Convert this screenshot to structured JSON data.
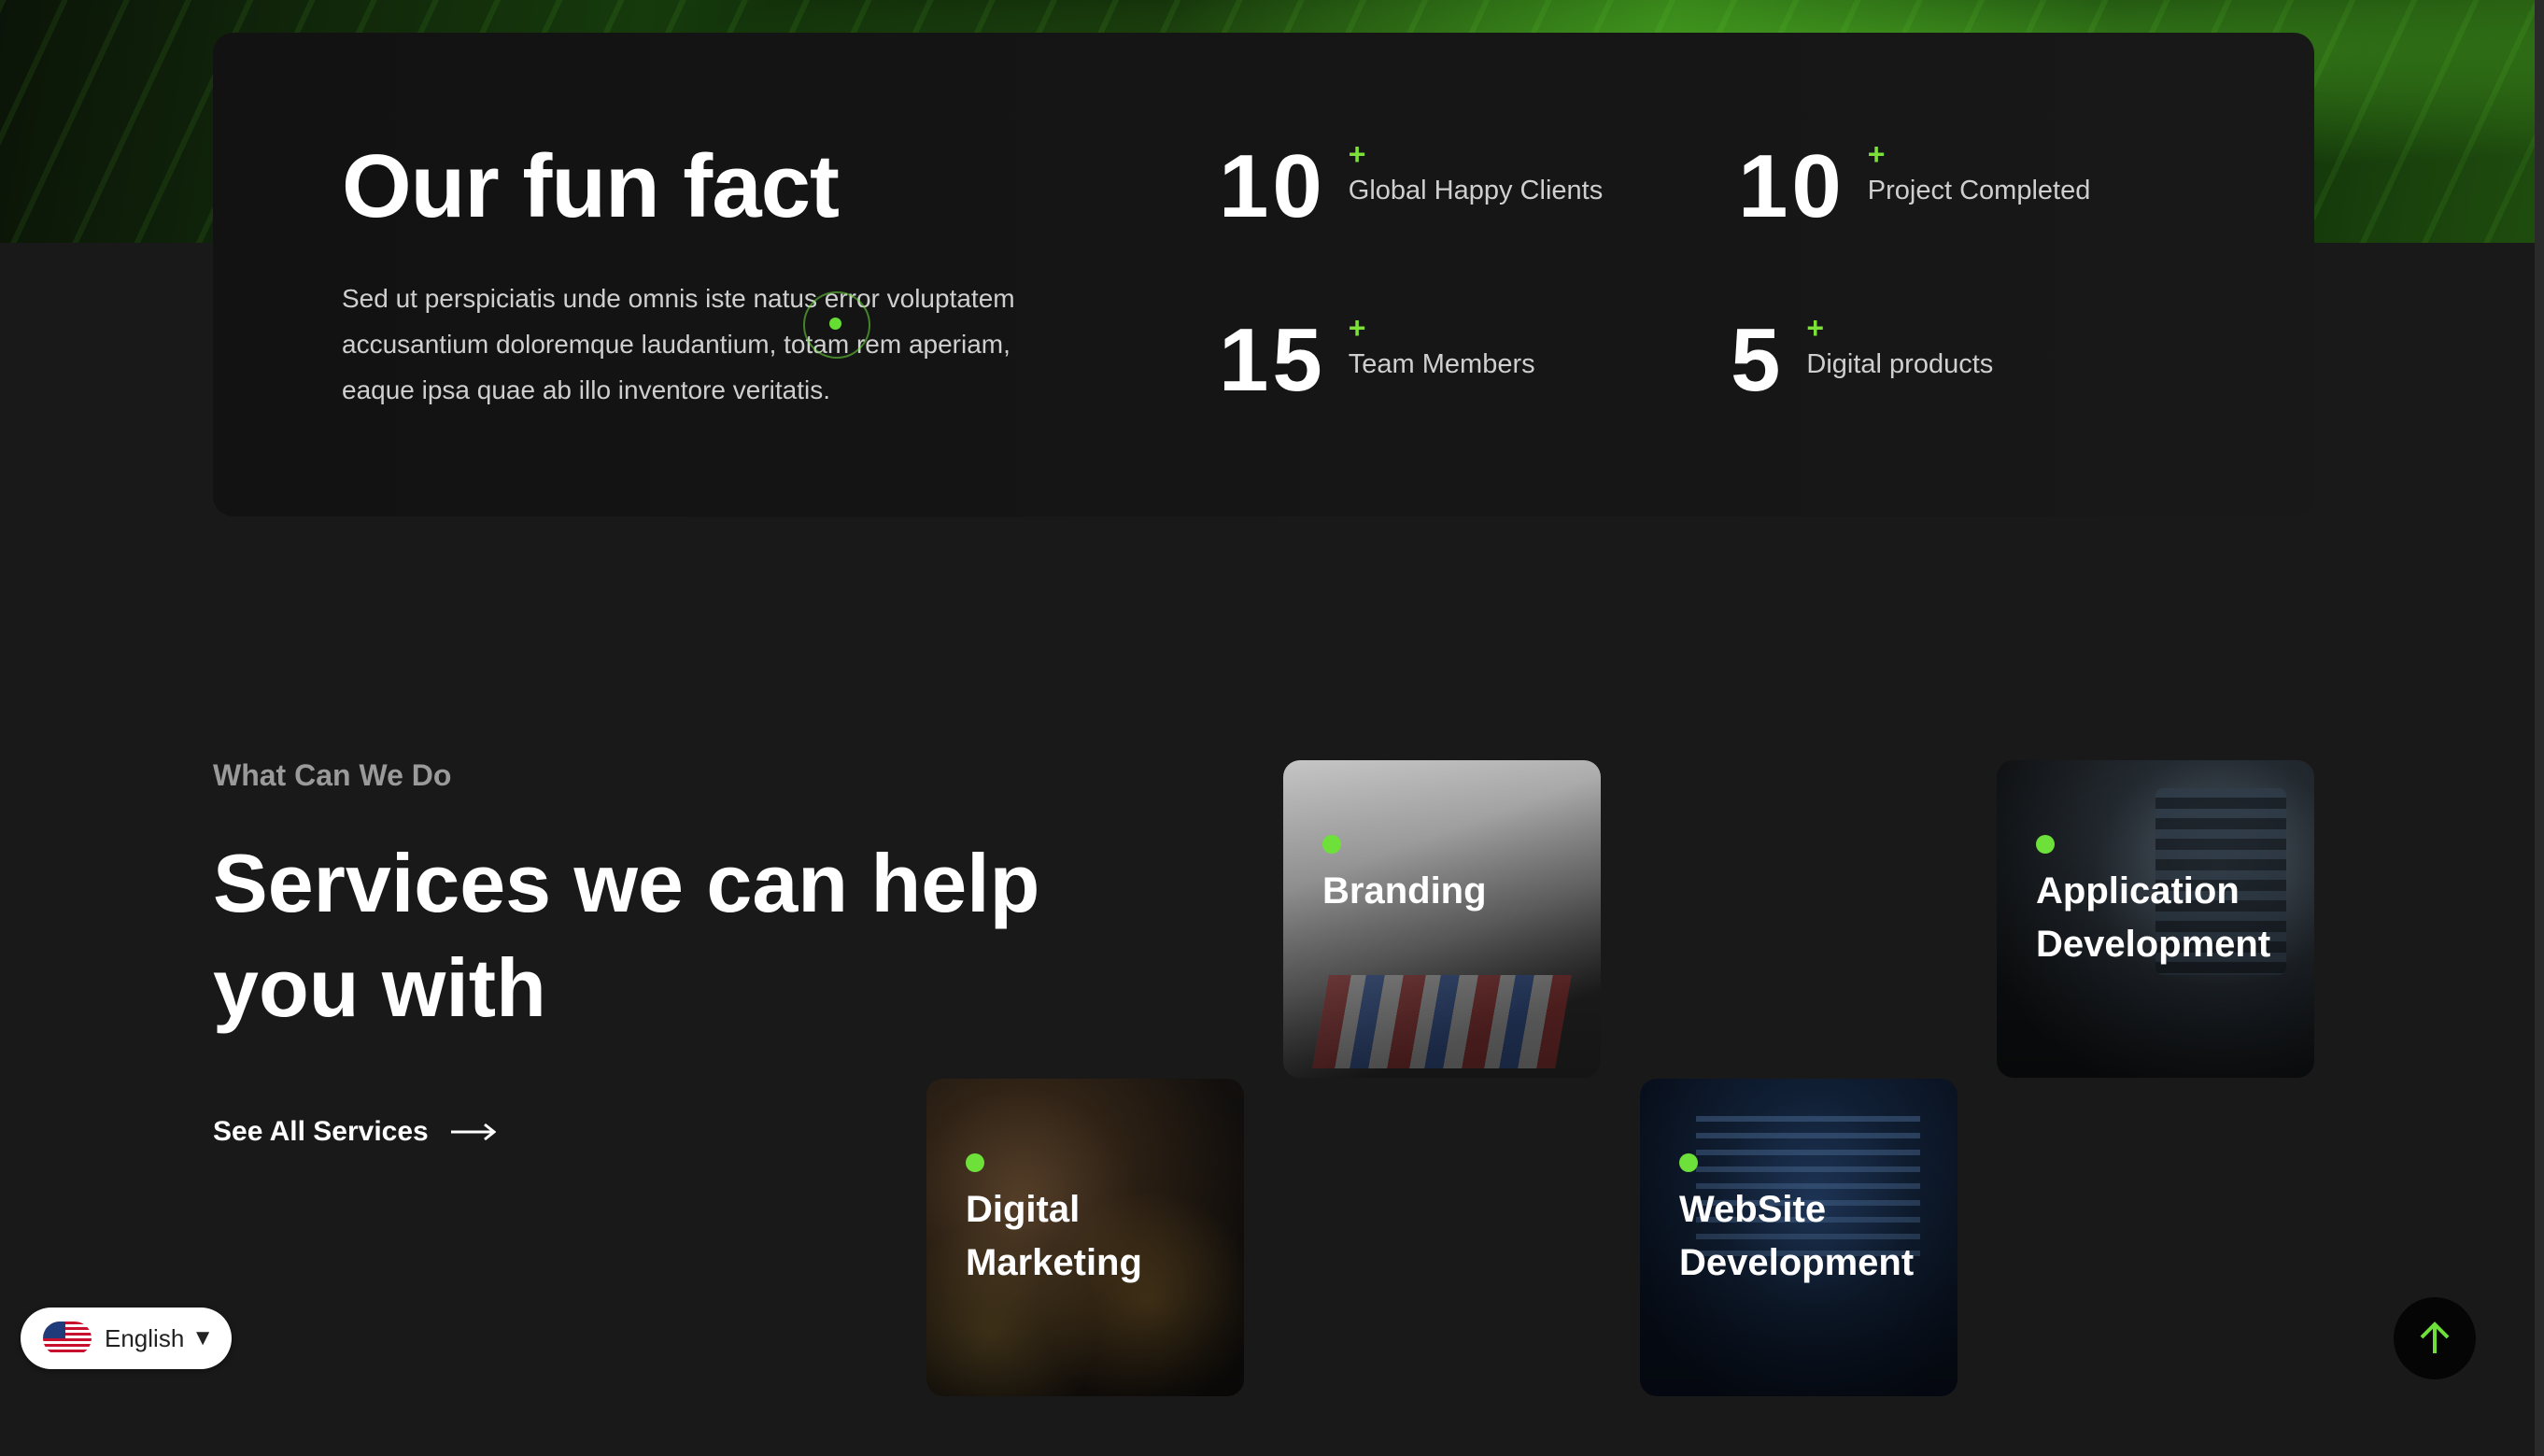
{
  "funfact": {
    "title": "Our fun fact",
    "description": "Sed ut perspiciatis unde omnis iste natus error voluptatem accusantium doloremque laudantium, totam rem aperiam, eaque ipsa quae ab illo inventore veritatis.",
    "stats": [
      {
        "number": "10",
        "plus": "+",
        "label": "Global Happy Clients"
      },
      {
        "number": "10",
        "plus": "+",
        "label": "Project Completed"
      },
      {
        "number": "15",
        "plus": "+",
        "label": "Team Members"
      },
      {
        "number": "5",
        "plus": "+",
        "label": "Digital products"
      }
    ]
  },
  "services": {
    "eyebrow": "What Can We Do",
    "title": "Services we can help you with",
    "see_all": "See All Services",
    "cards": [
      {
        "label": "Branding"
      },
      {
        "label": "Application Development"
      },
      {
        "label": "Digital Marketing"
      },
      {
        "label": "WebSite Development"
      }
    ]
  },
  "language": {
    "selected": "English",
    "caret": "▼"
  },
  "colors": {
    "accent": "#6ee03a",
    "background": "#191919",
    "card": "#141414"
  },
  "icons": {
    "arrow_right": "arrow-right-icon",
    "scroll_top": "arrow-up-icon",
    "flag": "us-flag-icon"
  }
}
